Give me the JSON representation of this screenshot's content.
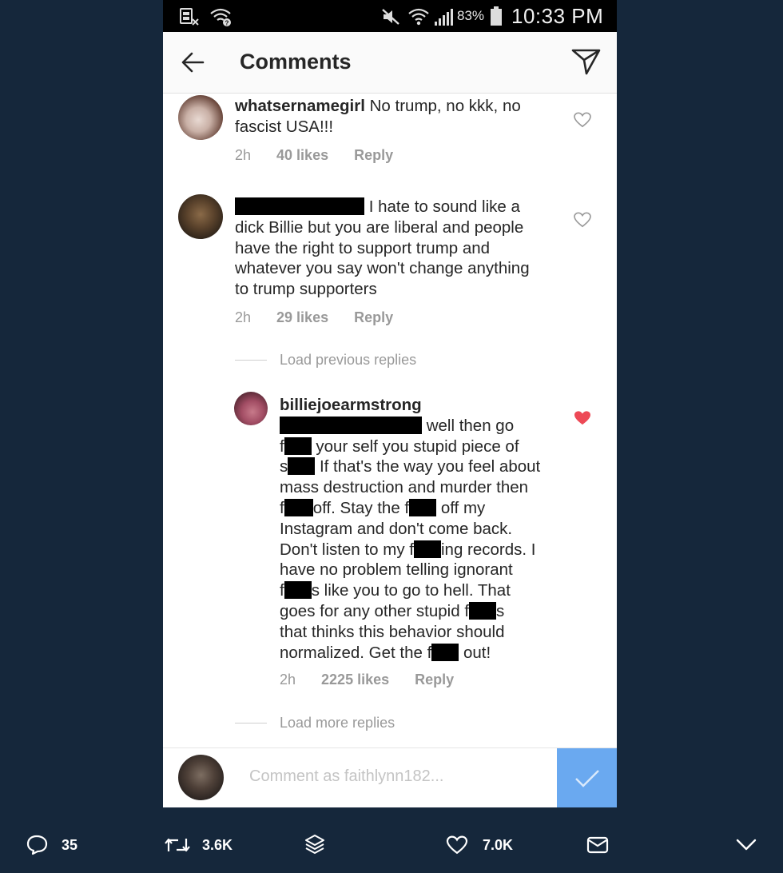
{
  "status_bar": {
    "battery_percent": "83%",
    "time": "10:33 PM"
  },
  "header": {
    "title": "Comments"
  },
  "comments": [
    {
      "username": "whatsernamegirl",
      "text": " No trump, no kkk, no fascist USA!!!",
      "time": "2h",
      "likes": "40 likes",
      "reply": "Reply"
    },
    {
      "text_lines": [
        "I hate to sound like a",
        "dick Billie but you are liberal and people",
        "have the right to support trump and",
        "whatever you say won't change anything",
        "to trump supporters"
      ],
      "time": "2h",
      "likes": "29 likes",
      "reply": "Reply"
    }
  ],
  "load_previous": "Load previous replies",
  "reply_comment": {
    "username": "billiejoearmstrong",
    "lines": [
      [
        "",
        "well then go"
      ],
      [
        "f",
        "your self you stupid piece of"
      ],
      [
        "s",
        "If that's the way you feel about"
      ],
      [
        "mass destruction and murder then"
      ],
      [
        "f",
        "off. Stay the f",
        "off my"
      ],
      [
        "Instagram and don't come back."
      ],
      [
        "Don't listen to my f",
        "ing records. I"
      ],
      [
        "have no problem telling ignorant"
      ],
      [
        "f",
        "s like you to go to hell. That"
      ],
      [
        "goes for any other stupid f",
        "s"
      ],
      [
        "that thinks this behavior should"
      ],
      [
        "normalized. Get the f",
        "out!"
      ]
    ],
    "time": "2h",
    "likes": "2225 likes",
    "reply": "Reply",
    "liked_color": "#ed4956"
  },
  "load_more": "Load more replies",
  "composer": {
    "placeholder": "Comment as faithlynn182..."
  },
  "tweet_actions": {
    "replies": "35",
    "retweets": "3.6K",
    "likes": "7.0K"
  },
  "colors": {
    "page_bg": "#15273b",
    "post_button": "#6aa9f0"
  }
}
